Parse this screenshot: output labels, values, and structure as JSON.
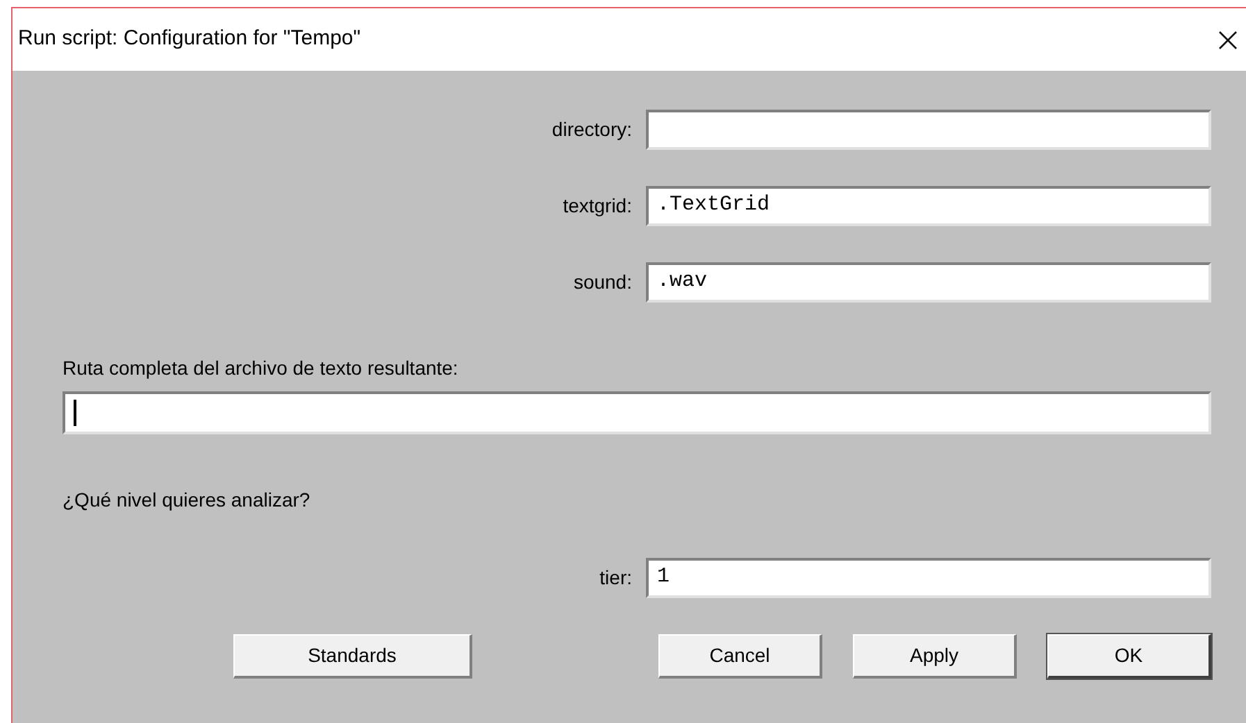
{
  "window": {
    "title": "Run script: Configuration for \"Tempo\""
  },
  "form": [
    {
      "kind": "row",
      "label": "directory:",
      "focused": false
    },
    {
      "kind": "row",
      "label": "textgrid:",
      "value": ".TextGrid",
      "focused": false
    },
    {
      "kind": "row",
      "label": "sound:",
      "value": ".wav",
      "focused": false
    },
    {
      "kind": "heading",
      "label": "Ruta completa del archivo de texto resultante:"
    },
    {
      "kind": "wide",
      "focused": true
    },
    {
      "kind": "heading",
      "label": "¿Qué nivel quieres analizar?"
    },
    {
      "kind": "row",
      "label": "tier:",
      "value": "1",
      "focused": false
    }
  ],
  "buttons": [
    {
      "label": "Standards",
      "default": false
    },
    {
      "label": "Cancel",
      "default": false
    },
    {
      "label": "Apply",
      "default": false
    },
    {
      "label": "OK",
      "default": true
    }
  ]
}
